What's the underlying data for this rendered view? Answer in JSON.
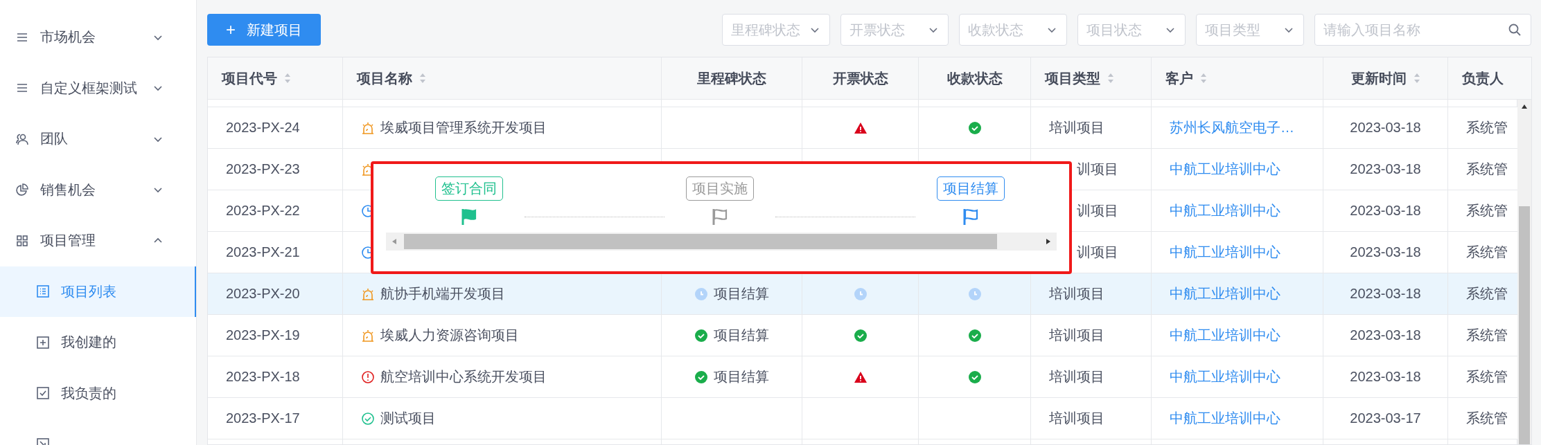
{
  "sidebar": {
    "items": [
      {
        "label": "市场机会",
        "expanded": false
      },
      {
        "label": "自定义框架测试",
        "expanded": false
      },
      {
        "label": "团队",
        "expanded": false
      },
      {
        "label": "销售机会",
        "expanded": false
      },
      {
        "label": "项目管理",
        "expanded": true,
        "children": [
          {
            "label": "项目列表",
            "selected": true
          },
          {
            "label": "我创建的",
            "selected": false
          },
          {
            "label": "我负责的",
            "selected": false
          },
          {
            "selected": false
          }
        ]
      }
    ]
  },
  "toolbar": {
    "new_button": {
      "icon": "+",
      "label": "新建项目"
    },
    "filters": [
      {
        "placeholder": "里程碑状态"
      },
      {
        "placeholder": "开票状态"
      },
      {
        "placeholder": "收款状态"
      },
      {
        "placeholder": "项目状态"
      },
      {
        "placeholder": "项目类型"
      }
    ],
    "search": {
      "placeholder": "请输入项目名称"
    }
  },
  "table": {
    "columns": [
      {
        "label": "项目代号",
        "sortable": true
      },
      {
        "label": "项目名称",
        "sortable": true
      },
      {
        "label": "里程碑状态",
        "sortable": false
      },
      {
        "label": "开票状态",
        "sortable": false
      },
      {
        "label": "收款状态",
        "sortable": false
      },
      {
        "label": "项目类型",
        "sortable": true
      },
      {
        "label": "客户",
        "sortable": true
      },
      {
        "label": "更新时间",
        "sortable": true
      },
      {
        "label": "负责人",
        "sortable": false
      }
    ],
    "rows": [
      {
        "code": "2023-PX-24",
        "name": {
          "kind": "alarm",
          "label": "埃威项目管理系统开发项目"
        },
        "invoice": {
          "kind": "warning"
        },
        "payment": {
          "kind": "check"
        },
        "type": "培训项目",
        "customer": "苏州长风航空电子…",
        "updated": "2023-03-18",
        "owner": "系统管",
        "selected": false,
        "covered": false
      },
      {
        "code": "2023-PX-23",
        "name": {
          "kind": "alarm"
        },
        "type": "训项目",
        "customer": "中航工业培训中心",
        "updated": "2023-03-18",
        "owner": "系统管",
        "selected": false,
        "covered": true
      },
      {
        "code": "2023-PX-22",
        "name": {
          "kind": "clock"
        },
        "type": "训项目",
        "customer": "中航工业培训中心",
        "updated": "2023-03-18",
        "owner": "系统管",
        "selected": false,
        "covered": true
      },
      {
        "code": "2023-PX-21",
        "name": {
          "kind": "clock"
        },
        "type": "训项目",
        "customer": "中航工业培训中心",
        "updated": "2023-03-18",
        "owner": "系统管",
        "selected": false,
        "covered": true
      },
      {
        "code": "2023-PX-20",
        "name": {
          "kind": "alarm",
          "label": "航协手机端开发项目"
        },
        "milestone": {
          "kind": "clock",
          "label": "项目结算"
        },
        "invoice": {
          "kind": "clock"
        },
        "payment": {
          "kind": "clock"
        },
        "type": "培训项目",
        "customer": "中航工业培训中心",
        "updated": "2023-03-18",
        "owner": "系统管",
        "selected": true,
        "covered": false
      },
      {
        "code": "2023-PX-19",
        "name": {
          "kind": "alarm",
          "label": "埃威人力资源咨询项目"
        },
        "milestone": {
          "kind": "check",
          "label": "项目结算"
        },
        "invoice": {
          "kind": "check"
        },
        "payment": {
          "kind": "check"
        },
        "type": "培训项目",
        "customer": "中航工业培训中心",
        "updated": "2023-03-18",
        "owner": "系统管",
        "selected": false,
        "covered": false
      },
      {
        "code": "2023-PX-18",
        "name": {
          "kind": "error",
          "label": "航空培训中心系统开发项目"
        },
        "milestone": {
          "kind": "check",
          "label": "项目结算"
        },
        "invoice": {
          "kind": "warning"
        },
        "payment": {
          "kind": "check"
        },
        "type": "培训项目",
        "customer": "中航工业培训中心",
        "updated": "2023-03-18",
        "owner": "系统管",
        "selected": false,
        "covered": false
      },
      {
        "code": "2023-PX-17",
        "name": {
          "kind": "ok",
          "label": "测试项目"
        },
        "type": "培训项目",
        "customer": "中航工业培训中心",
        "updated": "2023-03-17",
        "owner": "系统管",
        "selected": false,
        "covered": false
      }
    ]
  },
  "milestone_popup": {
    "steps": [
      {
        "label": "签订合同",
        "kind": "done"
      },
      {
        "label": "项目实施",
        "kind": "todo"
      },
      {
        "label": "项目结算",
        "kind": "current"
      }
    ]
  }
}
